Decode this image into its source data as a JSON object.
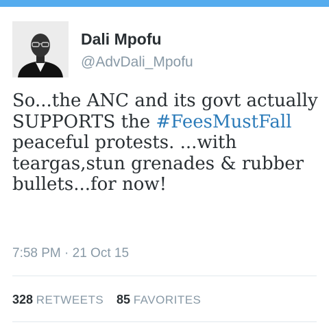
{
  "tweet": {
    "author_name": "Dali Mpofu",
    "author_handle": "@AdvDali_Mpofu",
    "avatar_icon": "profile-photo",
    "text_before": "So...the ANC and its govt actually SUPPORTS the ",
    "hashtag": "#FeesMustFall",
    "text_after": " peaceful protests. ...with teargas,stun grenades & rubber bullets...for now!",
    "timestamp": "7:58 PM · 21 Oct 15",
    "retweets_count": "328",
    "retweets_label": "RETWEETS",
    "favorites_count": "85",
    "favorites_label": "FAVORITES"
  },
  "colors": {
    "accent": "#55acee",
    "hashtag": "#2b7bb9",
    "muted_text": "#8899a6",
    "primary_text": "#292f33"
  }
}
